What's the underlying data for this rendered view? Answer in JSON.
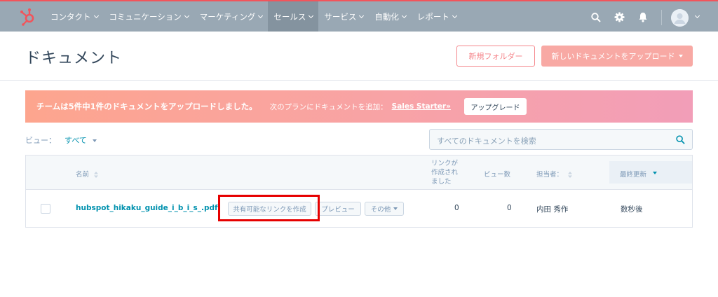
{
  "nav": {
    "items": [
      {
        "label": "コンタクト"
      },
      {
        "label": "コミュニケーション"
      },
      {
        "label": "マーケティング"
      },
      {
        "label": "セールス"
      },
      {
        "label": "サービス"
      },
      {
        "label": "自動化"
      },
      {
        "label": "レポート"
      }
    ],
    "active": "セールス",
    "accent_color": "#f2545b"
  },
  "header": {
    "title": "ドキュメント",
    "new_folder_label": "新規フォルダー",
    "upload_label": "新しいドキュメントをアップロード"
  },
  "banner": {
    "main_text": "チームは5件中1件のドキュメントをアップロードしました。",
    "sub_text": "次のプランにドキュメントを追加：",
    "link_text": "Sales Starter»",
    "button_label": "アップグレード"
  },
  "filter": {
    "view_label": "ビュー：",
    "view_value": "すべて"
  },
  "search": {
    "placeholder": "すべてのドキュメントを検索"
  },
  "table": {
    "headers": {
      "name": "名前",
      "link_created_1": "リンクが",
      "link_created_2": "作成され",
      "link_created_3": "ました",
      "views": "ビュー数",
      "owner": "担当者：",
      "last_updated": "最終更新"
    },
    "rows": [
      {
        "name": "hubspot_hikaku_guide_i_b_i_s_.pdf",
        "share_button": "共有可能なリンクを作成",
        "preview_button": "プレビュー",
        "more_button": "その他",
        "links": "0",
        "views": "0",
        "owner": "内田 秀作",
        "updated": "数秒後"
      }
    ]
  }
}
